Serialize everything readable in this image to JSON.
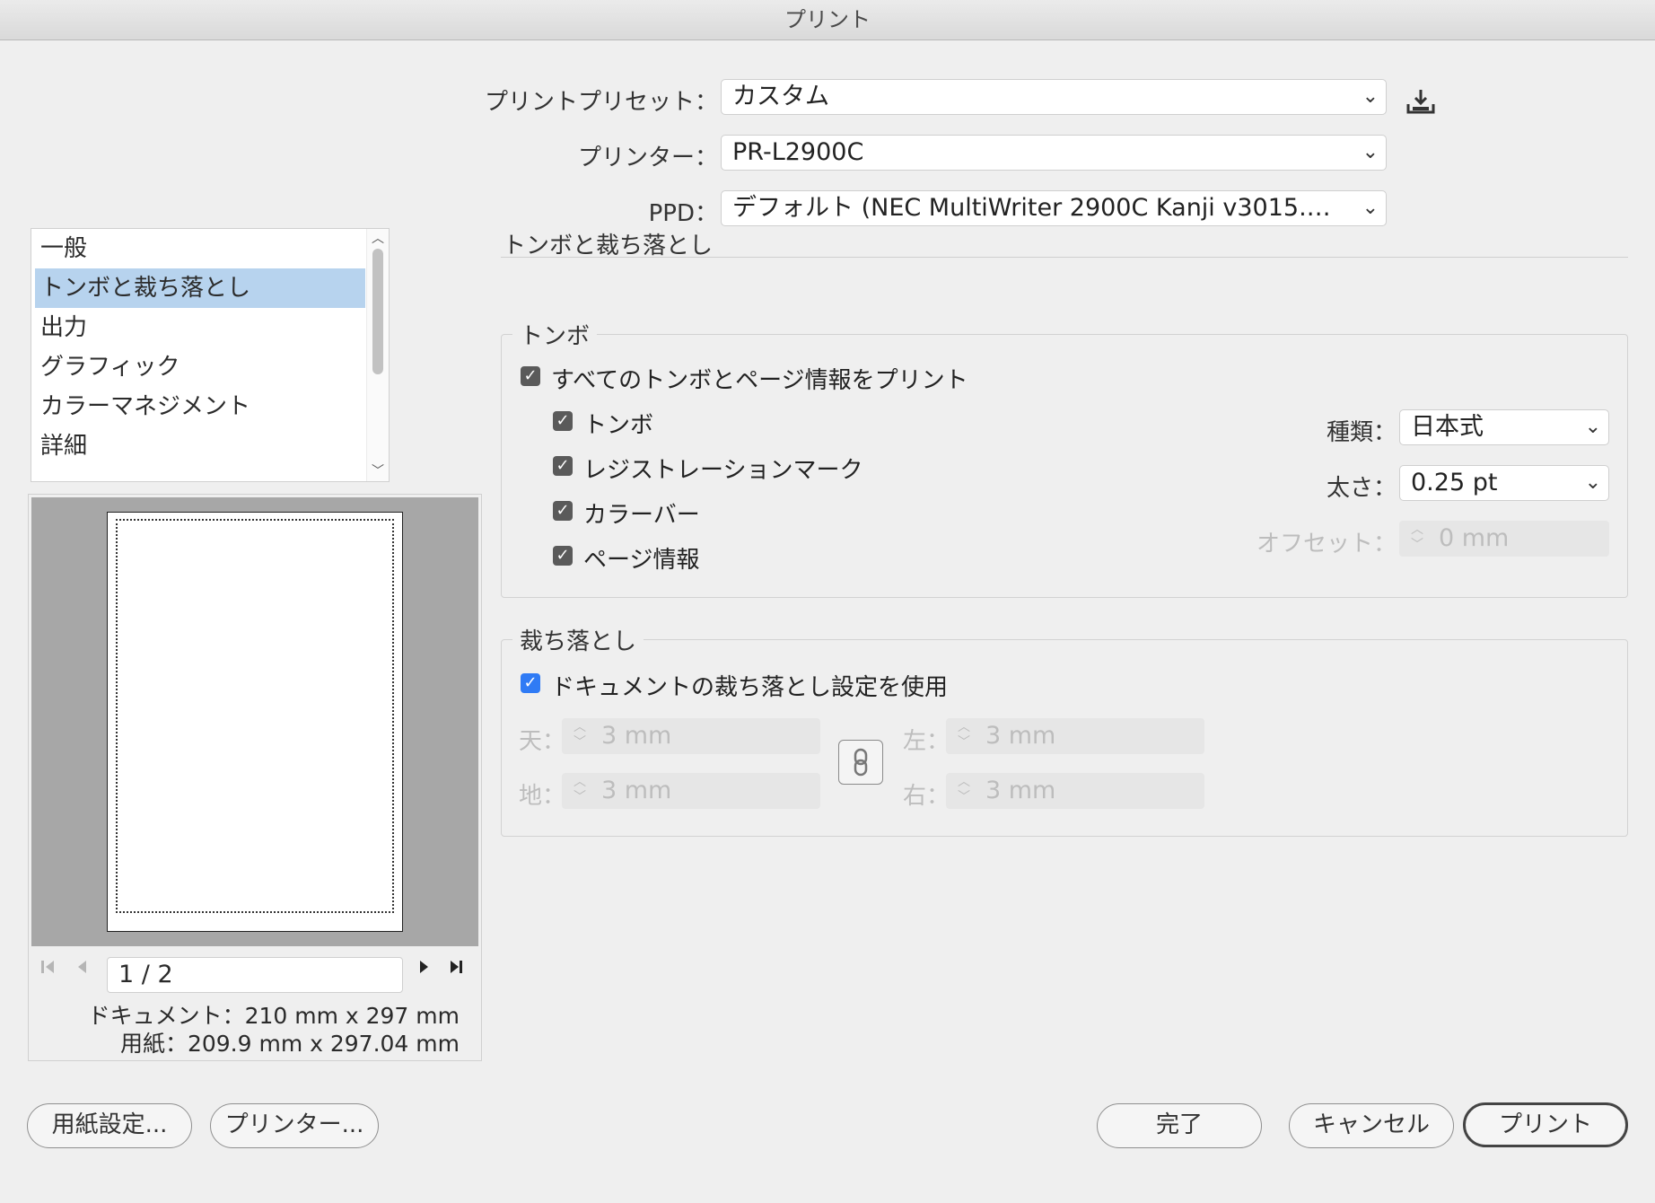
{
  "window": {
    "title": "プリント"
  },
  "top": {
    "preset_label": "プリントプリセット：",
    "preset_value": "カスタム",
    "printer_label": "プリンター：",
    "printer_value": "PR-L2900C",
    "ppd_label": "PPD：",
    "ppd_value": "デフォルト (NEC MultiWriter 2900C Kanji v3015.103..."
  },
  "sidebar": {
    "items": [
      {
        "label": "一般",
        "selected": false
      },
      {
        "label": "トンボと裁ち落とし",
        "selected": true
      },
      {
        "label": "出力",
        "selected": false
      },
      {
        "label": "グラフィック",
        "selected": false
      },
      {
        "label": "カラーマネジメント",
        "selected": false
      },
      {
        "label": "詳細",
        "selected": false
      }
    ]
  },
  "preview": {
    "page_indicator": "1 / 2",
    "document_size": "ドキュメント：210 mm x 297 mm",
    "paper_size": "用紙：209.9 mm x 297.04 mm"
  },
  "main": {
    "section_title": "トンボと裁ち落とし",
    "marks": {
      "group_title": "トンボ",
      "all_marks": {
        "label": "すべてのトンボとページ情報をプリント",
        "checked": true
      },
      "options": [
        {
          "label": "トンボ",
          "checked": true
        },
        {
          "label": "レジストレーションマーク",
          "checked": true
        },
        {
          "label": "カラーバー",
          "checked": true
        },
        {
          "label": "ページ情報",
          "checked": true
        }
      ],
      "type_label": "種類：",
      "type_value": "日本式",
      "weight_label": "太さ：",
      "weight_value": "0.25 pt",
      "offset_label": "オフセット：",
      "offset_value": "0 mm"
    },
    "bleed": {
      "group_title": "裁ち落とし",
      "use_doc": {
        "label": "ドキュメントの裁ち落とし設定を使用",
        "checked": true
      },
      "top_label": "天：",
      "top_value": "3 mm",
      "bottom_label": "地：",
      "bottom_value": "3 mm",
      "left_label": "左：",
      "left_value": "3 mm",
      "right_label": "右：",
      "right_value": "3 mm"
    }
  },
  "buttons": {
    "page_setup": "用紙設定...",
    "printer": "プリンター...",
    "done": "完了",
    "cancel": "キャンセル",
    "print": "プリント"
  },
  "colors": {
    "selection": "#b7d3ee",
    "checkbox_blue": "#2f7bf5",
    "checkbox_gray": "#5a5a5a"
  },
  "icons": [
    "save-preset-icon",
    "chevron-down-icon",
    "first-page-icon",
    "prev-page-icon",
    "next-page-icon",
    "last-page-icon",
    "chain-link-icon"
  ]
}
